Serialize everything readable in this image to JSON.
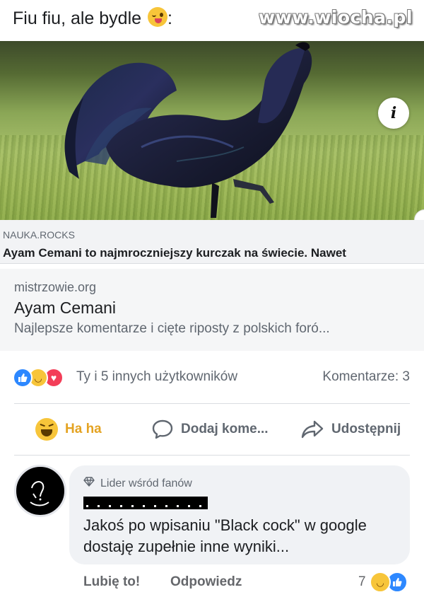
{
  "post": {
    "title": "Fiu fiu, ale bydle",
    "title_suffix": ":",
    "watermark": "www.wiocha.pl"
  },
  "photo": {
    "info_button": "i"
  },
  "shared": {
    "source": "NAUKA.ROCKS",
    "headline": "Ayam Cemani to najmroczniejszy kurczak na świecie. Nawet"
  },
  "link_card": {
    "domain": "mistrzowie.org",
    "title": "Ayam Cemani",
    "description": "Najlepsze komentarze i cięte riposty z polskich foró..."
  },
  "reactions": {
    "summary": "Ty i 5 innych użytkowników",
    "comments": "Komentarze: 3",
    "icons": [
      "like-icon",
      "haha-icon",
      "love-icon"
    ]
  },
  "actions": {
    "haha": "Ha ha",
    "comment": "Dodaj kome...",
    "share": "Udostępnij"
  },
  "comment": {
    "badge": "Lider wśród fanów",
    "text": "Jakoś po wpisaniu \"Black cock\" w google dostaję zupełnie inne wyniki...",
    "like": "Lubię to!",
    "reply": "Odpowiedz",
    "reaction_count": "7"
  },
  "colors": {
    "accent_blue": "#2d88ff",
    "haha_yellow": "#f7c53a",
    "love_red": "#f33e58",
    "muted_text": "#606770"
  }
}
